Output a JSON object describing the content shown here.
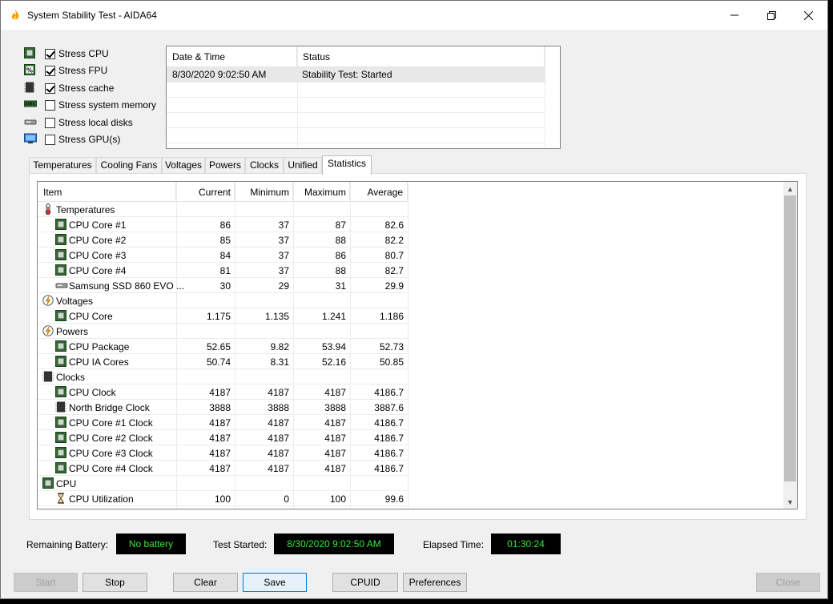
{
  "window": {
    "title": "System Stability Test - AIDA64"
  },
  "stress_options": [
    {
      "label": "Stress CPU",
      "checked": true,
      "icon": "cpu-icon"
    },
    {
      "label": "Stress FPU",
      "checked": true,
      "icon": "fpu-icon"
    },
    {
      "label": "Stress cache",
      "checked": true,
      "icon": "cache-icon"
    },
    {
      "label": "Stress system memory",
      "checked": false,
      "icon": "memory-icon"
    },
    {
      "label": "Stress local disks",
      "checked": false,
      "icon": "disk-icon"
    },
    {
      "label": "Stress GPU(s)",
      "checked": false,
      "icon": "gpu-icon"
    }
  ],
  "log": {
    "headers": [
      "Date & Time",
      "Status"
    ],
    "rows": [
      [
        "8/30/2020 9:02:50 AM",
        "Stability Test: Started"
      ]
    ]
  },
  "tabs": [
    {
      "label": "Temperatures",
      "active": false
    },
    {
      "label": "Cooling Fans",
      "active": false
    },
    {
      "label": "Voltages",
      "active": false
    },
    {
      "label": "Powers",
      "active": false
    },
    {
      "label": "Clocks",
      "active": false
    },
    {
      "label": "Unified",
      "active": false
    },
    {
      "label": "Statistics",
      "active": true
    }
  ],
  "stats": {
    "headers": [
      "Item",
      "Current",
      "Minimum",
      "Maximum",
      "Average"
    ],
    "rows": [
      {
        "kind": "group",
        "label": "Temperatures",
        "icon": "thermometer-icon"
      },
      {
        "kind": "item",
        "label": "CPU Core #1",
        "icon": "cpu-chip-icon",
        "current": "86",
        "min": "37",
        "max": "87",
        "avg": "82.6"
      },
      {
        "kind": "item",
        "label": "CPU Core #2",
        "icon": "cpu-chip-icon",
        "current": "85",
        "min": "37",
        "max": "88",
        "avg": "82.2"
      },
      {
        "kind": "item",
        "label": "CPU Core #3",
        "icon": "cpu-chip-icon",
        "current": "84",
        "min": "37",
        "max": "86",
        "avg": "80.7"
      },
      {
        "kind": "item",
        "label": "CPU Core #4",
        "icon": "cpu-chip-icon",
        "current": "81",
        "min": "37",
        "max": "88",
        "avg": "82.7"
      },
      {
        "kind": "item",
        "label": "Samsung SSD 860 EVO ...",
        "icon": "ssd-icon",
        "current": "30",
        "min": "29",
        "max": "31",
        "avg": "29.9"
      },
      {
        "kind": "group",
        "label": "Voltages",
        "icon": "bolt-icon"
      },
      {
        "kind": "item",
        "label": "CPU Core",
        "icon": "cpu-chip-icon",
        "current": "1.175",
        "min": "1.135",
        "max": "1.241",
        "avg": "1.186"
      },
      {
        "kind": "group",
        "label": "Powers",
        "icon": "bolt-icon"
      },
      {
        "kind": "item",
        "label": "CPU Package",
        "icon": "cpu-chip-icon",
        "current": "52.65",
        "min": "9.82",
        "max": "53.94",
        "avg": "52.73"
      },
      {
        "kind": "item",
        "label": "CPU IA Cores",
        "icon": "cpu-chip-icon",
        "current": "50.74",
        "min": "8.31",
        "max": "52.16",
        "avg": "50.85"
      },
      {
        "kind": "group",
        "label": "Clocks",
        "icon": "clock-chip-icon"
      },
      {
        "kind": "item",
        "label": "CPU Clock",
        "icon": "cpu-chip-icon",
        "current": "4187",
        "min": "4187",
        "max": "4187",
        "avg": "4186.7"
      },
      {
        "kind": "item",
        "label": "North Bridge Clock",
        "icon": "northbridge-icon",
        "current": "3888",
        "min": "3888",
        "max": "3888",
        "avg": "3887.6"
      },
      {
        "kind": "item",
        "label": "CPU Core #1 Clock",
        "icon": "cpu-chip-icon",
        "current": "4187",
        "min": "4187",
        "max": "4187",
        "avg": "4186.7"
      },
      {
        "kind": "item",
        "label": "CPU Core #2 Clock",
        "icon": "cpu-chip-icon",
        "current": "4187",
        "min": "4187",
        "max": "4187",
        "avg": "4186.7"
      },
      {
        "kind": "item",
        "label": "CPU Core #3 Clock",
        "icon": "cpu-chip-icon",
        "current": "4187",
        "min": "4187",
        "max": "4187",
        "avg": "4186.7"
      },
      {
        "kind": "item",
        "label": "CPU Core #4 Clock",
        "icon": "cpu-chip-icon",
        "current": "4187",
        "min": "4187",
        "max": "4187",
        "avg": "4186.7"
      },
      {
        "kind": "group",
        "label": "CPU",
        "icon": "cpu-chip-icon"
      },
      {
        "kind": "item",
        "label": "CPU Utilization",
        "icon": "hourglass-icon",
        "current": "100",
        "min": "0",
        "max": "100",
        "avg": "99.6"
      }
    ]
  },
  "status": {
    "battery_label": "Remaining Battery:",
    "battery_value": "No battery",
    "started_label": "Test Started:",
    "started_value": "8/30/2020 9:02:50 AM",
    "elapsed_label": "Elapsed Time:",
    "elapsed_value": "01:30:24"
  },
  "buttons": {
    "start": "Start",
    "stop": "Stop",
    "clear": "Clear",
    "save": "Save",
    "cpuid": "CPUID",
    "preferences": "Preferences",
    "close": "Close"
  },
  "colors": {
    "status_text": "#32e83a",
    "status_bg": "#000000",
    "focus": "#0078d7"
  }
}
